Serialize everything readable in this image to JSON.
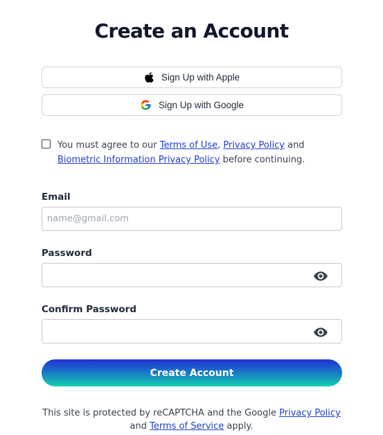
{
  "page": {
    "title": "Create an Account"
  },
  "social": {
    "apple_label": "Sign Up with Apple",
    "apple_icon": "apple-icon",
    "google_label": "Sign Up with Google",
    "google_icon": "google-icon"
  },
  "agreement": {
    "checked": false,
    "prefix": "You must agree to our ",
    "terms_link": "Terms of Use",
    "sep1": ", ",
    "privacy_link": "Privacy Policy",
    "sep2": " and ",
    "biometric_link": "Biometric Information Privacy Policy",
    "suffix": " before continuing."
  },
  "form": {
    "email_label": "Email",
    "email_placeholder": "name@gmail.com",
    "email_value": "",
    "password_label": "Password",
    "password_value": "",
    "confirm_label": "Confirm Password",
    "confirm_value": "",
    "eye_icon": "eye-icon",
    "submit_label": "Create Account"
  },
  "footer": {
    "line1_prefix": "This site is protected by reCAPTCHA and the Google ",
    "privacy_link": "Privacy Policy",
    "line2_prefix": "and ",
    "terms_link": "Terms of Service",
    "line2_suffix": " apply."
  },
  "colors": {
    "link": "#1d3ec9",
    "button_gradient_top": "#2330d6",
    "button_gradient_bottom": "#12d2b0",
    "title": "#0f172a"
  }
}
